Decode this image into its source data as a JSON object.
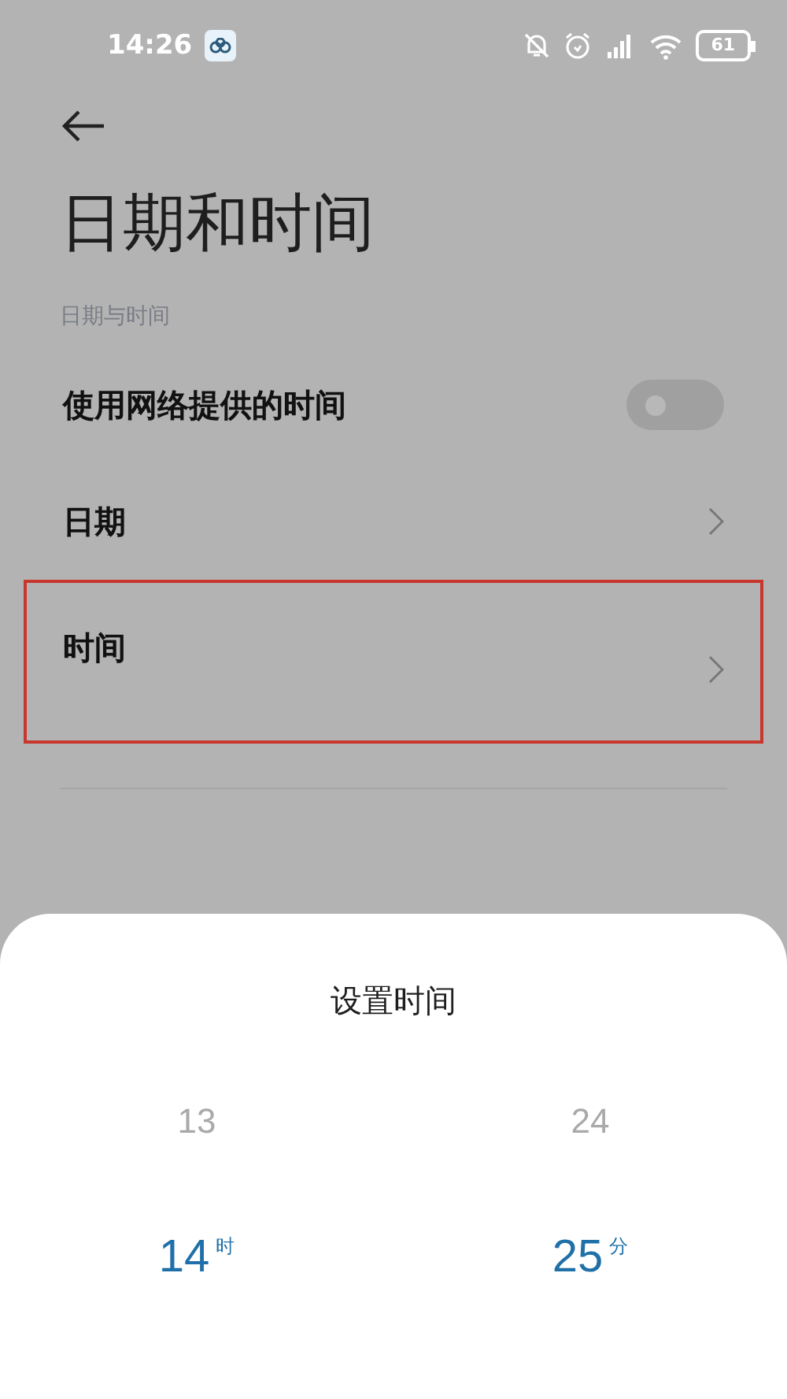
{
  "status_bar": {
    "time": "14:26",
    "battery": "61"
  },
  "page": {
    "title": "日期和时间",
    "section": "日期与时间"
  },
  "rows": [
    {
      "kind": "toggle",
      "label": "使用网络提供的时间",
      "on": false,
      "highlighted": false
    },
    {
      "kind": "link",
      "label": "日期",
      "highlighted": false
    },
    {
      "kind": "link",
      "label": "时间",
      "highlighted": true
    }
  ],
  "sheet": {
    "title": "设置时间",
    "columns": [
      {
        "items": [
          {
            "value": "13",
            "selected": false
          },
          {
            "value": "14",
            "unit": "时",
            "selected": true
          }
        ]
      },
      {
        "items": [
          {
            "value": "24",
            "selected": false
          },
          {
            "value": "25",
            "unit": "分",
            "selected": true
          }
        ]
      }
    ]
  }
}
